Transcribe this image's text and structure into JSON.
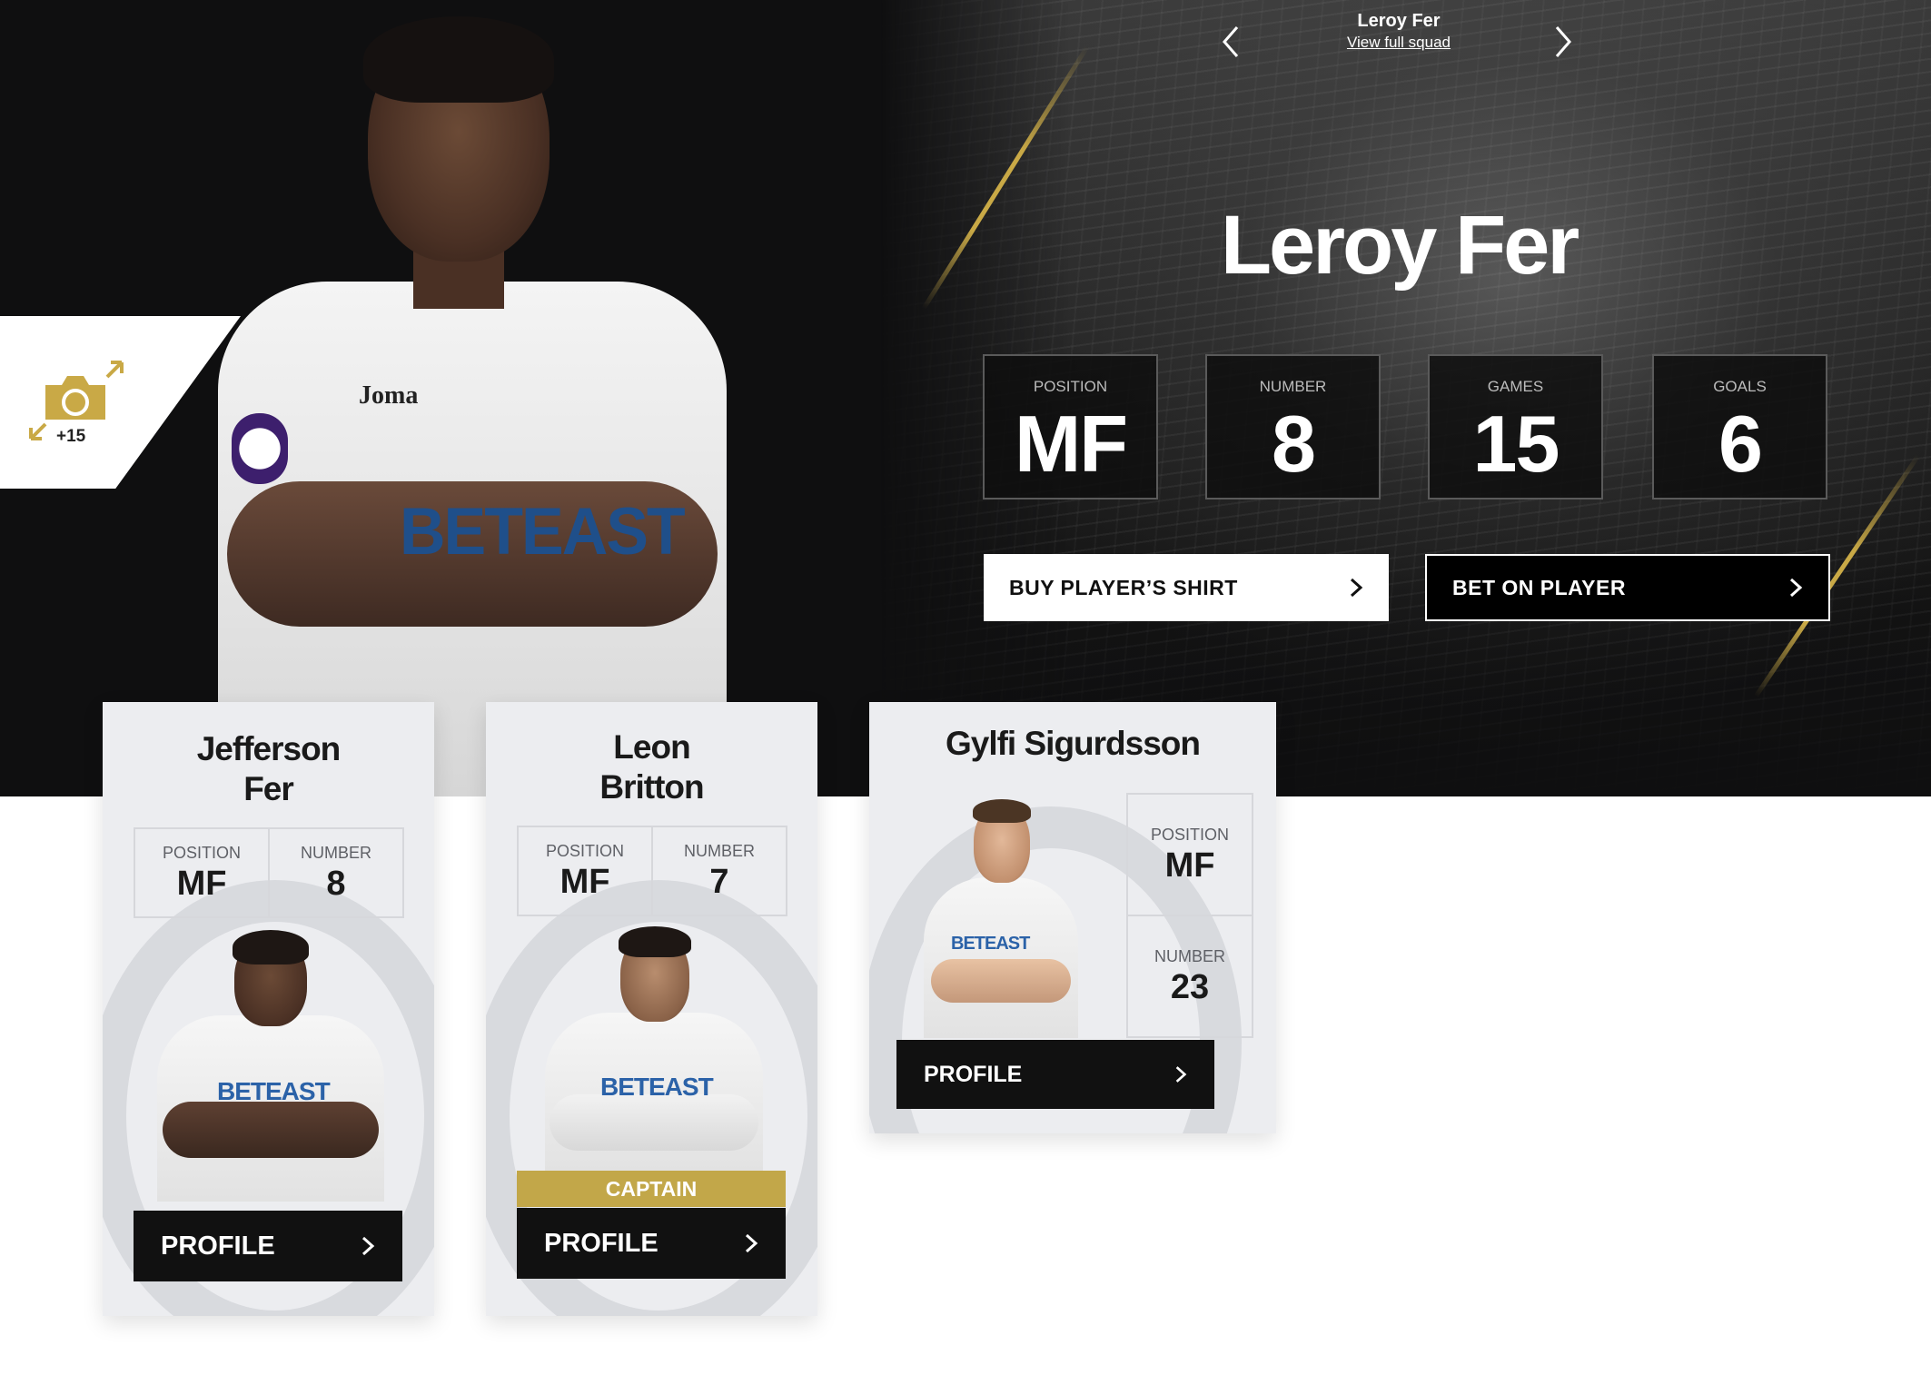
{
  "colors": {
    "gold": "#c9a946",
    "hero_bg": "#0f0f10",
    "card_bg": "#ecedf0",
    "sponsor_blue": "#2b62a8"
  },
  "gallery": {
    "count": "+15",
    "icon": "camera-icon"
  },
  "squad_nav": {
    "player_name": "Leroy Fer",
    "view_link": "View full squad"
  },
  "hero": {
    "player_name": "Leroy Fer",
    "shirt_brand": "Joma",
    "shirt_sponsor": "BETEAST",
    "stats": [
      {
        "label": "POSITION",
        "value": "MF"
      },
      {
        "label": "NUMBER",
        "value": "8"
      },
      {
        "label": "GAMES",
        "value": "15"
      },
      {
        "label": "GOALS",
        "value": "6"
      }
    ],
    "buy_shirt": "BUY PLAYER’S SHIRT",
    "bet": "BET ON PLAYER"
  },
  "cards": [
    {
      "name_line1": "Jefferson",
      "name_line2": "Fer",
      "position_label": "POSITION",
      "position": "MF",
      "number_label": "NUMBER",
      "number": "8",
      "sponsor": "BETEAST",
      "profile": "PROFILE"
    },
    {
      "name_line1": "Leon",
      "name_line2": "Britton",
      "position_label": "POSITION",
      "position": "MF",
      "number_label": "NUMBER",
      "number": "7",
      "sponsor": "BETEAST",
      "captain": "CAPTAIN",
      "profile": "PROFILE"
    },
    {
      "name": "Gylfi Sigurdsson",
      "position_label": "POSITION",
      "position": "MF",
      "number_label": "NUMBER",
      "number": "23",
      "sponsor": "BETEAST",
      "profile": "PROFILE"
    }
  ]
}
